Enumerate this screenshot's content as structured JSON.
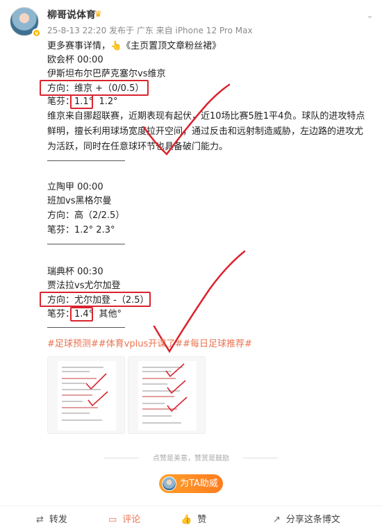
{
  "post": {
    "username": "柳哥说体育",
    "meta": "25-8-13 22:20  发布于 广东  来自 iPhone 12 Pro Max",
    "intro": "更多赛事详情，👆《主页置顶文章粉丝裙》",
    "match1": {
      "league_time": "欧会杯 00:00",
      "teams": "伊斯坦布尔巴萨克塞尔vs维京",
      "direction": "方向：维京 +（0/0.5）",
      "odds_prefix": "笔芬：",
      "odds_boxed": "1.1°",
      "odds_rest": "1.2°",
      "analysis": "维京来自挪超联赛，近期表现有起伏，近10场比赛5胜1平4负。球队的进攻特点鲜明，擅长利用球场宽度拉开空间，通过反击和远射制造威胁，左边路的进攻尤为活跃，同时在任意球环节也具备破门能力。"
    },
    "match2": {
      "league_time": "立陶甲 00:00",
      "teams": "班加vs黑格尔曼",
      "direction": "方向：高（2/2.5）",
      "odds": "笔芬：1.2°  2.3°"
    },
    "match3": {
      "league_time": "瑞典杯 00:30",
      "teams": "贾法拉vs尤尔加登",
      "direction": "方向：尤尔加登 -（2.5）",
      "odds_prefix": "笔芬：",
      "odds_boxed": "1.4°",
      "odds_rest": "其他°"
    },
    "tags": "#足球预测##体育vplus开课了##每日足球推荐#",
    "divider_text": "点赞是美意，赞赏是鼓励",
    "support_label": "为TA助威"
  },
  "bottom_bar": {
    "repost": "转发",
    "comment": "评论",
    "like": "赞",
    "share": "分享这条博文"
  },
  "colors": {
    "accent": "#eb7350",
    "annotation_red": "#d9232d",
    "button_orange": "#ff8a22"
  }
}
